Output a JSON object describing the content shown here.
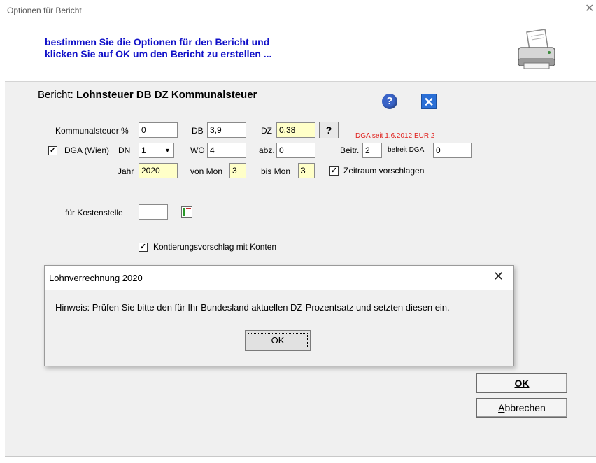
{
  "window": {
    "title": "Optionen für Bericht",
    "close_glyph": "✕"
  },
  "header": {
    "line1": "bestimmen Sie die Optionen für den Bericht und",
    "line2": "klicken Sie auf OK um den Bericht zu erstellen ...",
    "icon": "printer-icon"
  },
  "report": {
    "prefix": "Bericht:",
    "name": "Lohnsteuer DB DZ Kommunalsteuer",
    "help_icon": "help-icon",
    "close_icon": "close-x-icon"
  },
  "fields": {
    "kommunalsteuer_label": "Kommunalsteuer %",
    "kommunalsteuer_value": "0",
    "db_label": "DB",
    "db_value": "3,9",
    "dz_label": "DZ",
    "dz_value": "0,38",
    "dz_help_label": "?",
    "dga_note": "DGA seit 1.6.2012 EUR 2",
    "dga_checked": "✓",
    "dga_label": "DGA (Wien)",
    "dn_label": "DN",
    "dn_value": "1",
    "dn_arrow": "▼",
    "wo_label": "WO",
    "wo_value": "4",
    "abz_label": "abz.",
    "abz_value": "0",
    "beitr_label": "Beitr.",
    "beitr_value": "2",
    "befreit_label": "befreit DGA",
    "befreit_value": "0",
    "jahr_label": "Jahr",
    "jahr_value": "2020",
    "von_mon_label": "von Mon",
    "von_mon_value": "3",
    "bis_mon_label": "bis Mon",
    "bis_mon_value": "3",
    "zeitraum_checked": "✓",
    "zeitraum_label": "Zeitraum vorschlagen",
    "kostenstelle_label": "für Kostenstelle",
    "kostenstelle_value": "",
    "kontierung_checked": "✓",
    "kontierung_label": "Kontierungsvorschlag mit Konten"
  },
  "modal": {
    "title": "Lohnverrechnung 2020",
    "close_glyph": "✕",
    "message": "Hinweis: Prüfen Sie bitte den für Ihr Bundesland aktuellen DZ-Prozentsatz und setzten diesen ein.",
    "ok_label": "OK"
  },
  "buttons": {
    "ok_label": "OK",
    "cancel_label": "Abbrechen"
  },
  "colors": {
    "header_text": "#1010c8",
    "note_red": "#e0201c",
    "highlight_field": "#ffffc8"
  }
}
